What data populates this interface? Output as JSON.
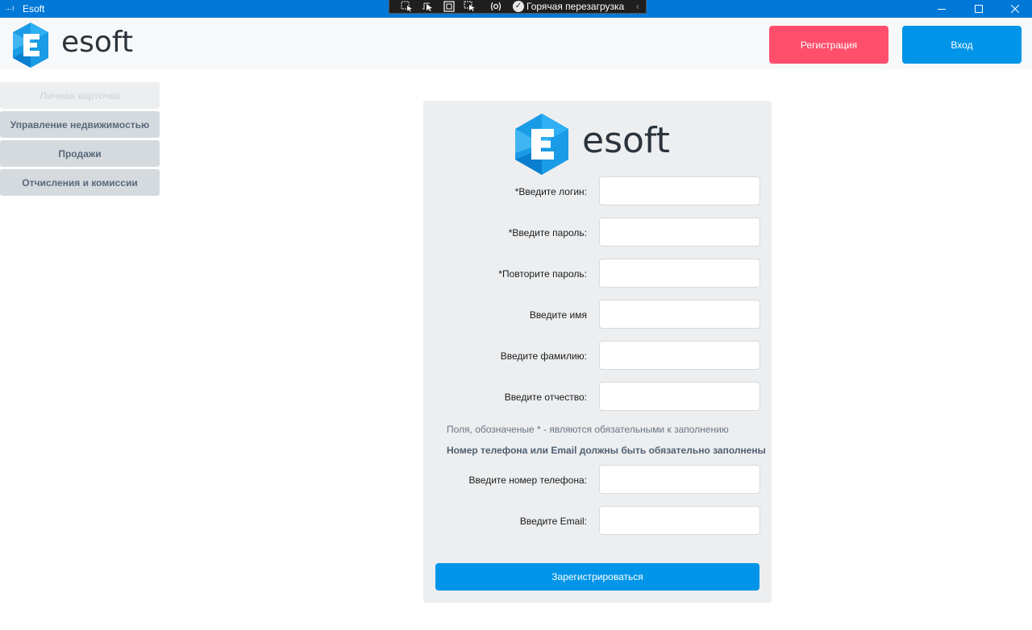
{
  "window": {
    "title": "Esoft",
    "app_icon": "·-·!",
    "devbar_label": "Горячая перезагрузка",
    "devbar_tools": [
      "select-element-icon",
      "pointer-icon",
      "layout-adorner-icon",
      "track-focus-icon",
      "binding-failures-icon"
    ],
    "controls": [
      "minimize-icon",
      "maximize-icon",
      "close-icon"
    ]
  },
  "header": {
    "logo_text": "esoft",
    "register_label": "Регистрация",
    "login_label": "Вход"
  },
  "sidebar": {
    "items": [
      {
        "label": "Личная карточка",
        "state": "disabled"
      },
      {
        "label": "Управление недвижимостью",
        "state": "normal"
      },
      {
        "label": "Продажи",
        "state": "normal"
      },
      {
        "label": "Отчисления и комиссии",
        "state": "normal"
      }
    ]
  },
  "form": {
    "logo_text": "esoft",
    "fields": [
      {
        "label": "*Введите логин:",
        "value": ""
      },
      {
        "label": "*Введите пароль:",
        "value": ""
      },
      {
        "label": "*Повторите пароль:",
        "value": ""
      },
      {
        "label": "Введите имя",
        "value": ""
      },
      {
        "label": "Введите фамилию:",
        "value": ""
      },
      {
        "label": "Введите отчество:",
        "value": ""
      }
    ],
    "required_note": "Поля, обозначеные * - являются обязательными к заполнению",
    "contact_note": "Номер телефона или Email должны быть обязательно заполнены",
    "contact_fields": [
      {
        "label": "Введите номер телефона:",
        "value": ""
      },
      {
        "label": "Введите Email:",
        "value": ""
      }
    ],
    "submit_label": "Зарегистрироваться"
  },
  "colors": {
    "titlebar": "#0078d7",
    "register_button": "#ff4f6d",
    "primary_button": "#0095e8",
    "panel": "#eceef0",
    "logo_blue": "#1a9be6",
    "logo_text": "#2b333b"
  }
}
